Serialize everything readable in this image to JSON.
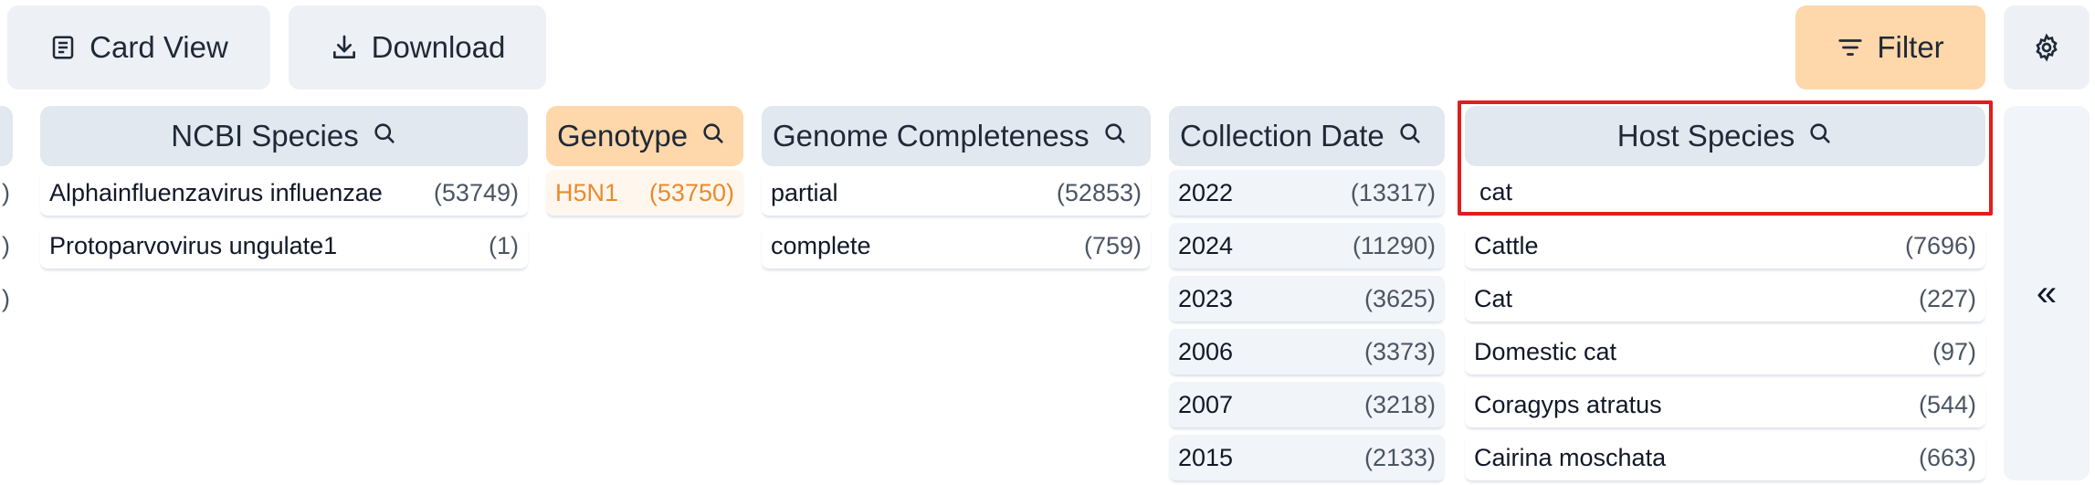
{
  "toolbar": {
    "card_view_label": "Card View",
    "download_label": "Download",
    "filter_label": "Filter",
    "settings_icon": "gear-icon"
  },
  "columns": {
    "ncbi_species": {
      "title": "NCBI Species",
      "rows": [
        {
          "label": "Alphainfluenzavirus influenzae",
          "count": "(53749)"
        },
        {
          "label": "Protoparvovirus ungulate1",
          "count": "(1)"
        }
      ]
    },
    "genotype": {
      "title": "Genotype",
      "rows": [
        {
          "label": "H5N1",
          "count": "(53750)"
        }
      ]
    },
    "genome_completeness": {
      "title": "Genome Completeness",
      "rows": [
        {
          "label": "partial",
          "count": "(52853)"
        },
        {
          "label": "complete",
          "count": "(759)"
        }
      ]
    },
    "collection_date": {
      "title": "Collection Date",
      "rows": [
        {
          "label": "2022",
          "count": "(13317)"
        },
        {
          "label": "2024",
          "count": "(11290)"
        },
        {
          "label": "2023",
          "count": "(3625)"
        },
        {
          "label": "2006",
          "count": "(3373)"
        },
        {
          "label": "2007",
          "count": "(3218)"
        },
        {
          "label": "2015",
          "count": "(2133)"
        }
      ]
    },
    "host_species": {
      "title": "Host Species",
      "search_value": "cat",
      "rows": [
        {
          "label": "Cattle",
          "count": "(7696)"
        },
        {
          "label": "Cat",
          "count": "(227)"
        },
        {
          "label": "Domestic cat",
          "count": "(97)"
        },
        {
          "label": "Coragyps atratus",
          "count": "(544)"
        },
        {
          "label": "Cairina moschata",
          "count": "(663)"
        }
      ]
    }
  },
  "left_edge_chars": [
    ")",
    ")",
    ")"
  ],
  "collapse_label": "«",
  "colors": {
    "accent": "#fed7aa",
    "selected_text": "#ea8a2b",
    "highlight_border": "#e11d1d"
  }
}
